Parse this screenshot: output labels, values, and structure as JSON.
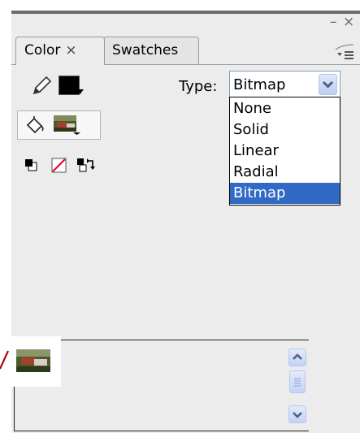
{
  "window": {
    "minimize_glyph": "–",
    "close_glyph": "×"
  },
  "tabs": [
    {
      "label": "Color",
      "close_glyph": "×",
      "active": true
    },
    {
      "label": "Swatches",
      "active": false
    }
  ],
  "panel_menu_icon": "panel-menu-icon",
  "stroke": {
    "icon": "pencil-icon",
    "color": "#000000"
  },
  "fill": {
    "icon": "paint-bucket-icon",
    "type": "bitmap"
  },
  "small_tools": [
    "black-and-white-icon",
    "no-color-icon",
    "swap-colors-icon"
  ],
  "type_control": {
    "label": "Type:",
    "value": "Bitmap",
    "options": [
      "None",
      "Solid",
      "Linear",
      "Radial",
      "Bitmap"
    ],
    "selected_index": 4
  },
  "colors": {
    "highlight": "#316ac5",
    "panel_bg": "#ececec",
    "arrow": "#a01010"
  }
}
